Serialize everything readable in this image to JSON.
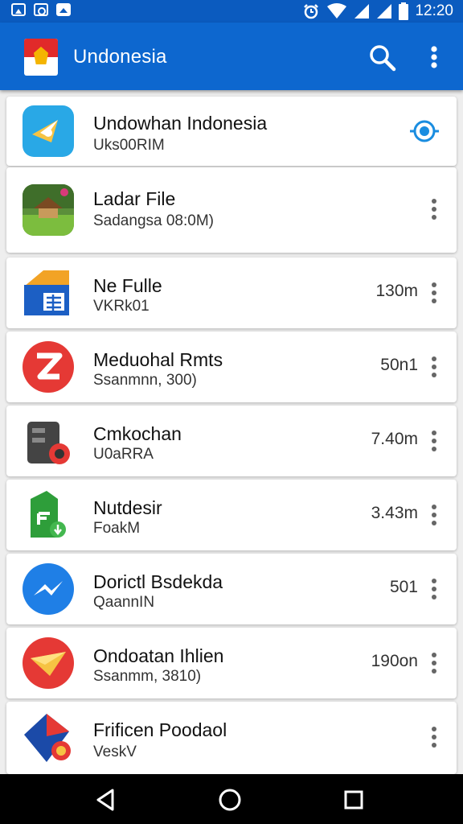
{
  "status_bar": {
    "time": "12:20",
    "left_icons": [
      "image-notification-icon",
      "gallery-notification-icon",
      "picture-notification-icon"
    ],
    "right_icons": [
      "alarm-icon",
      "wifi-icon",
      "signal-icon",
      "signal-icon",
      "battery-icon"
    ]
  },
  "app_bar": {
    "title": "Undonesia",
    "logo_icon": "indonesia-emblem-icon",
    "actions": [
      "search-icon",
      "more-vert-icon"
    ],
    "color": "#0d67cf"
  },
  "items": [
    {
      "name": "Undowhan Indonesia",
      "subtitle": "Uks00RIM",
      "size": "",
      "icon": "send-icon",
      "trailing": "sync-icon"
    },
    {
      "name": "Ladar File",
      "subtitle": "Sadangsa 08:0M)",
      "size": "",
      "icon": "village-photo-icon",
      "trailing": "more-vert-icon"
    },
    {
      "name": "Ne Fulle",
      "subtitle": "VKRk01",
      "size": "130m",
      "icon": "file-folder-icon",
      "trailing": "more-vert-icon"
    },
    {
      "name": "Meduohal Rmts",
      "subtitle": "Ssanmnn, 300)",
      "size": "50n1",
      "icon": "z-red-icon",
      "trailing": "more-vert-icon"
    },
    {
      "name": "Cmkochan",
      "subtitle": "U0aRRA",
      "size": "7.40m",
      "icon": "radio-icon",
      "trailing": "more-vert-icon"
    },
    {
      "name": "Nutdesir",
      "subtitle": "FoakM",
      "size": "3.43m",
      "icon": "green-download-icon",
      "trailing": "more-vert-icon"
    },
    {
      "name": "Dorictl Bsdekda",
      "subtitle": "QaannIN",
      "size": "501",
      "icon": "messenger-icon",
      "trailing": "more-vert-icon"
    },
    {
      "name": "Ondoatan Ihlien",
      "subtitle": "Ssanmm, 3810)",
      "size": "190on",
      "icon": "paper-plane-icon",
      "trailing": "more-vert-icon"
    },
    {
      "name": "Frificen Poodaol",
      "subtitle": "VeskV",
      "size": "",
      "icon": "shield-app-icon",
      "trailing": "more-vert-icon"
    }
  ],
  "nav_bar": {
    "buttons": [
      "back-icon",
      "home-icon",
      "recents-icon"
    ]
  },
  "colors": {
    "status_bar": "#0b5bbf",
    "app_bar": "#0d67cf",
    "accent": "#1a8de0"
  }
}
